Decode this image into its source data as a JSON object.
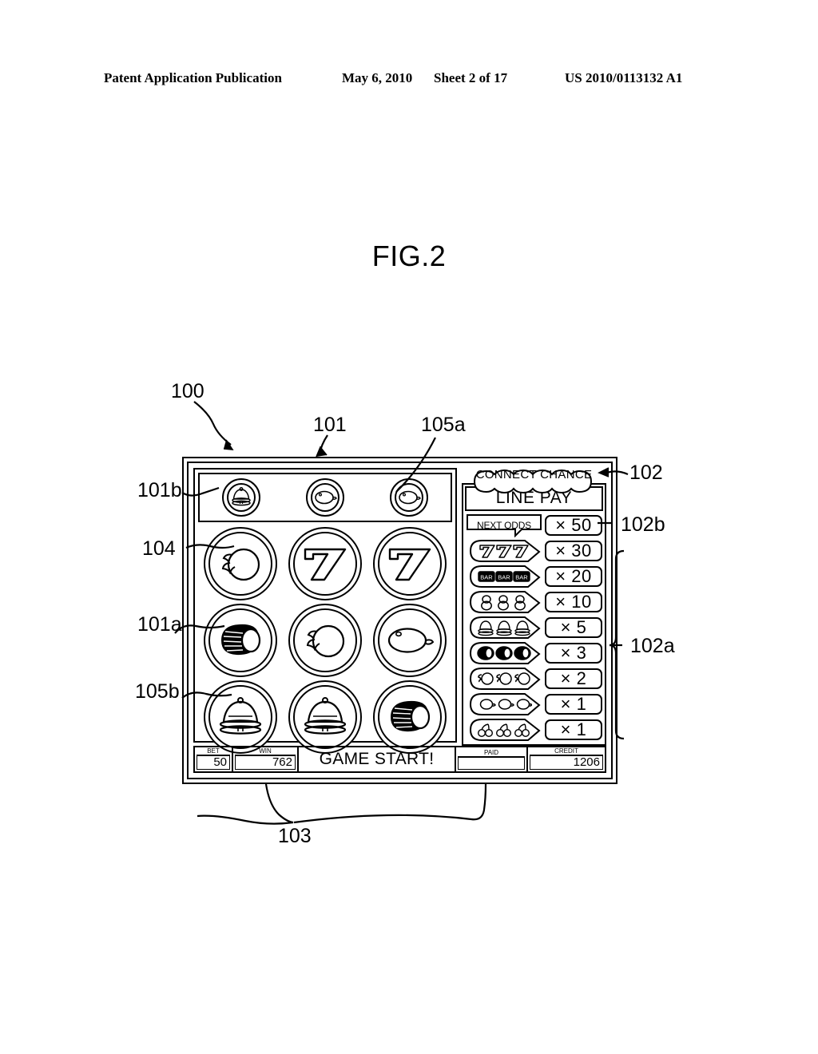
{
  "header": {
    "publication": "Patent Application Publication",
    "date": "May 6, 2010",
    "sheet": "Sheet 2 of 17",
    "patent_number": "US 2010/0113132 A1"
  },
  "figure": {
    "title": "FIG.2"
  },
  "machine": {
    "reels": {
      "top_row": [
        {
          "symbol": "bell-icon"
        },
        {
          "symbol": "lemon-icon"
        },
        {
          "symbol": "lemon-icon"
        }
      ],
      "rows": [
        [
          {
            "symbol": "apple-icon"
          },
          {
            "symbol": "seven-icon"
          },
          {
            "symbol": "seven-icon"
          }
        ],
        [
          {
            "symbol": "dark-bell-icon"
          },
          {
            "symbol": "apple-icon"
          },
          {
            "symbol": "lemon-icon"
          }
        ],
        [
          {
            "symbol": "bell-icon"
          },
          {
            "symbol": "bell-icon"
          },
          {
            "symbol": "dark-bell-icon"
          }
        ]
      ]
    },
    "paytable": {
      "banner": "CONNECT CHANCE",
      "title": "LINE PAY",
      "rows": [
        {
          "symbol_label": "NEXT ODDS",
          "symbol_type": "text",
          "multiplier": "× 50"
        },
        {
          "symbol_label": "777",
          "symbol_type": "seven-triple-icon",
          "multiplier": "× 30"
        },
        {
          "symbol_label": "BAR BAR BAR",
          "symbol_type": "bar-triple-icon",
          "multiplier": "× 20"
        },
        {
          "symbol_label": "888",
          "symbol_type": "eight-triple-icon",
          "multiplier": "× 10"
        },
        {
          "symbol_label": "BELL BELL BELL",
          "symbol_type": "bell-triple-icon",
          "multiplier": "× 5"
        },
        {
          "symbol_label": "DARK BELL x3",
          "symbol_type": "dark-bell-triple-icon",
          "multiplier": "× 3"
        },
        {
          "symbol_label": "APPLE APPLE APPLE",
          "symbol_type": "apple-triple-icon",
          "multiplier": "× 2"
        },
        {
          "symbol_label": "LEMON LEMON LEMON",
          "symbol_type": "lemon-triple-icon",
          "multiplier": "× 1"
        },
        {
          "symbol_label": "CHERRY CHERRY CHERRY",
          "symbol_type": "cherry-triple-icon",
          "multiplier": "× 1"
        }
      ]
    },
    "statusbar": {
      "bet_caption": "BET",
      "bet_value": "50",
      "win_caption": "WIN",
      "win_value": "762",
      "message": "GAME START!",
      "paid_caption": "PAID",
      "paid_value": "",
      "credit_caption": "CREDIT",
      "credit_value": "1206"
    }
  },
  "reference_numerals": {
    "n100": "100",
    "n101": "101",
    "n101a": "101a",
    "n101b": "101b",
    "n102": "102",
    "n102a": "102a",
    "n102b": "102b",
    "n103": "103",
    "n104": "104",
    "n105a": "105a",
    "n105b": "105b"
  }
}
